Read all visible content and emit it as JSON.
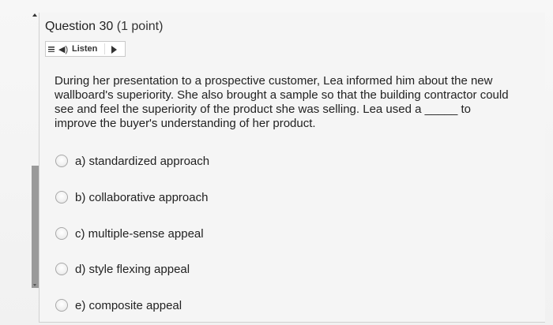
{
  "question": {
    "title": "Question 30",
    "points": "(1 point)",
    "text": "During her presentation to a prospective customer, Lea informed him about the new wallboard's superiority. She also brought a sample so that the building contractor could see and feel the superiority of the product she was selling. Lea used a _____ to improve the buyer's understanding of her product."
  },
  "listen": {
    "label": "Listen",
    "speaker_icon": "speaker-icon",
    "play_icon": "play-icon",
    "menu_icon": "menu-icon"
  },
  "options": [
    {
      "label": "a) standardized approach",
      "selected": false
    },
    {
      "label": "b) collaborative approach",
      "selected": false
    },
    {
      "label": "c) multiple-sense appeal",
      "selected": false
    },
    {
      "label": "d) style flexing appeal",
      "selected": false
    },
    {
      "label": "e) composite appeal",
      "selected": false
    }
  ]
}
